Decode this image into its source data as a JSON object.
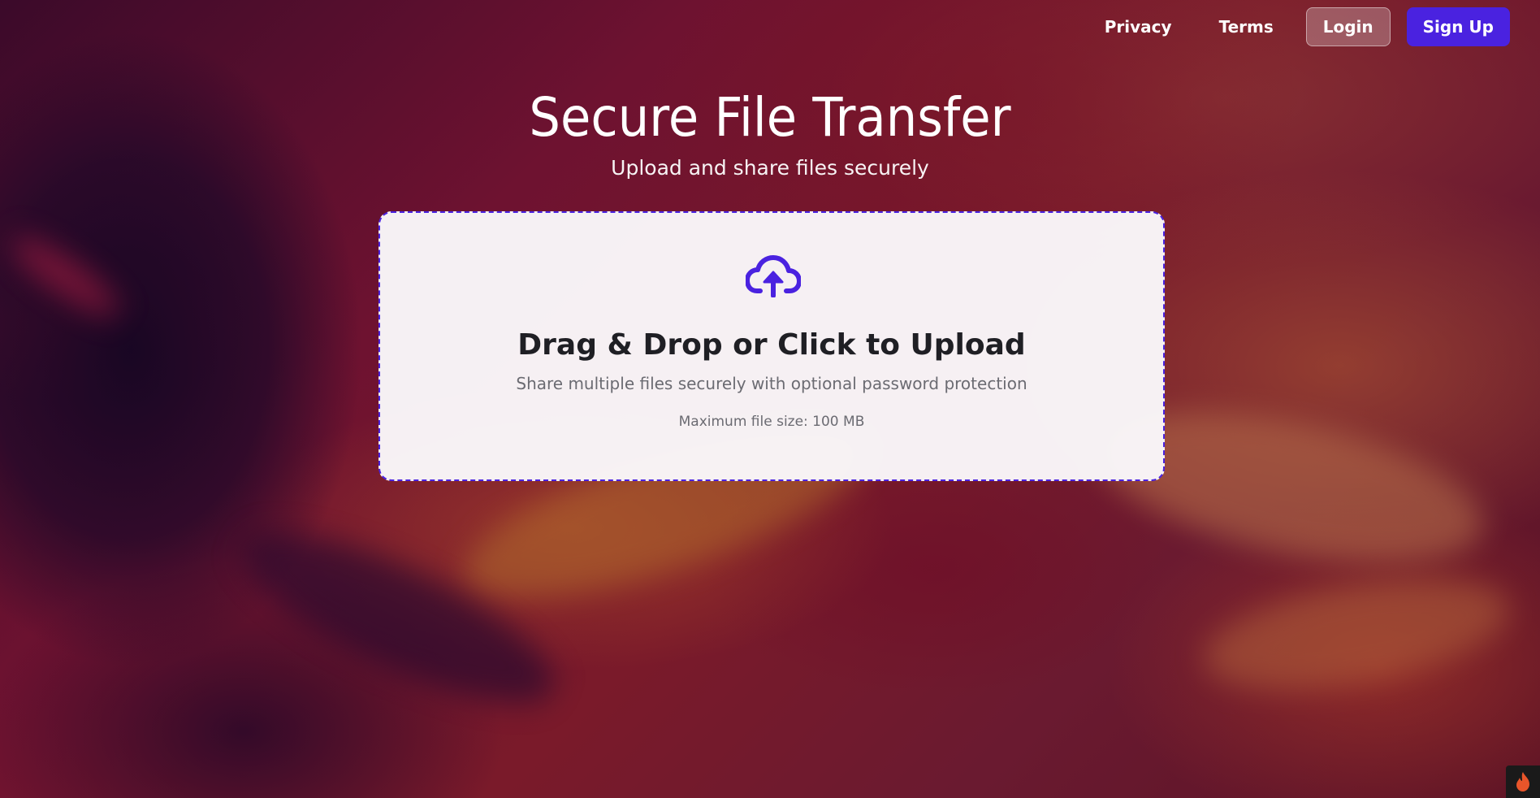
{
  "nav": {
    "privacy": "Privacy",
    "terms": "Terms",
    "login": "Login",
    "signup": "Sign Up"
  },
  "hero": {
    "title": "Secure File Transfer",
    "subtitle": "Upload and share files securely"
  },
  "upload": {
    "icon": "cloud-upload-icon",
    "title": "Drag & Drop or Click to Upload",
    "description": "Share multiple files securely with optional password protection",
    "limit": "Maximum file size: 100 MB"
  },
  "colors": {
    "accent": "#4a22e0",
    "badge": "#e8552a"
  }
}
